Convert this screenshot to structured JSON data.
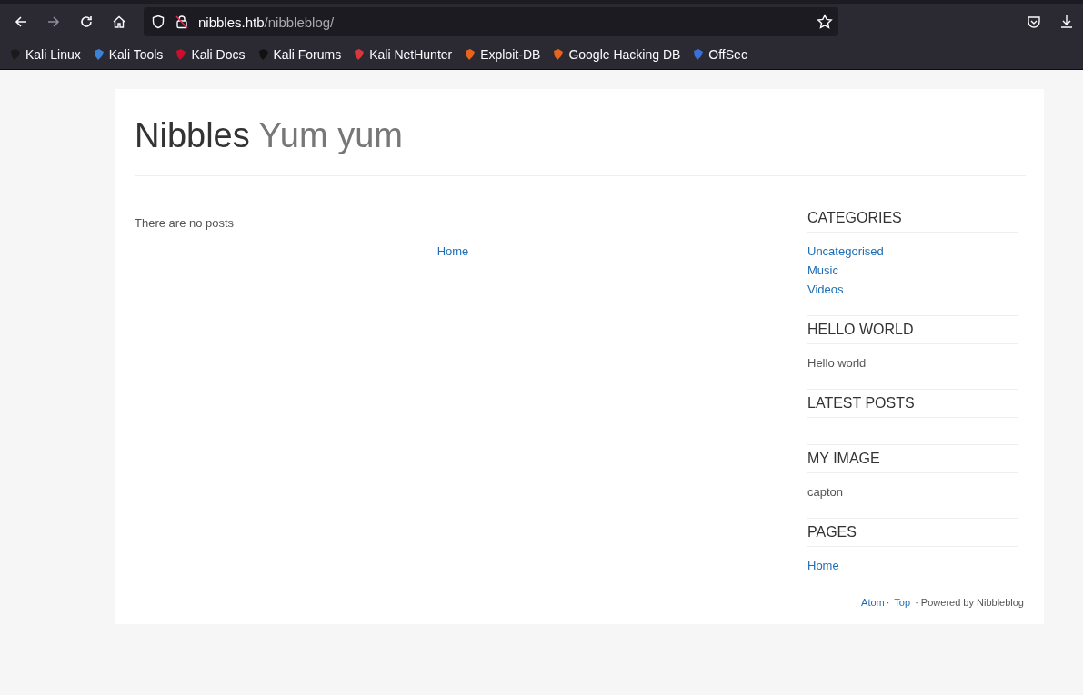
{
  "browser": {
    "url_host": "nibbles.htb",
    "url_path": "/nibbleblog/",
    "bookmarks": [
      {
        "label": "Kali Linux",
        "color": "#1a1a1a"
      },
      {
        "label": "Kali Tools",
        "color": "#3b82d6"
      },
      {
        "label": "Kali Docs",
        "color": "#c8102e"
      },
      {
        "label": "Kali Forums",
        "color": "#111111"
      },
      {
        "label": "Kali NetHunter",
        "color": "#d9363e"
      },
      {
        "label": "Exploit-DB",
        "color": "#e8631b"
      },
      {
        "label": "Google Hacking DB",
        "color": "#e8631b"
      },
      {
        "label": "OffSec",
        "color": "#3a6fd8"
      }
    ]
  },
  "blog": {
    "title": "Nibbles",
    "slogan": "Yum yum",
    "message": "There are no posts",
    "pager_link": "Home",
    "widgets": [
      {
        "title": "CATEGORIES",
        "kind": "links",
        "items": [
          "Uncategorised",
          "Music",
          "Videos"
        ]
      },
      {
        "title": "HELLO WORLD",
        "kind": "text",
        "items": [
          "Hello world"
        ]
      },
      {
        "title": "LATEST POSTS",
        "kind": "empty"
      },
      {
        "title": "MY IMAGE",
        "kind": "text",
        "items": [
          "capton"
        ]
      },
      {
        "title": "PAGES",
        "kind": "links",
        "items": [
          "Home"
        ]
      }
    ],
    "footer": {
      "links": [
        "Atom",
        "Top"
      ],
      "separator": "·",
      "credit": "· Powered by Nibbleblog"
    }
  }
}
